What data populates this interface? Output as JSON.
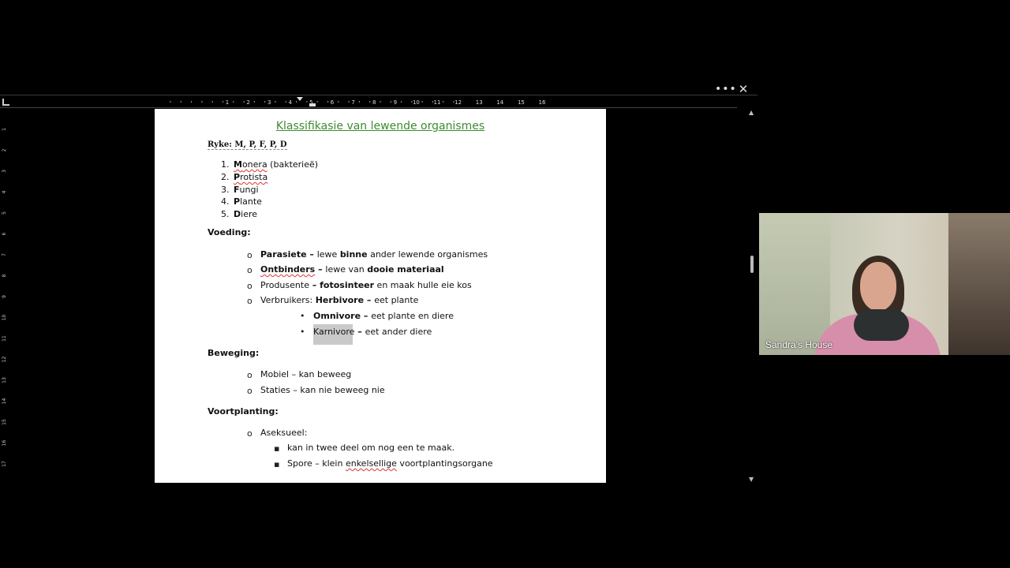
{
  "toolbar": {
    "more_icon": "more-horizontal-icon",
    "more_glyph": "•••",
    "close_icon": "close-icon",
    "close_glyph": "✕"
  },
  "ruler": {
    "h_ticks": [
      "1",
      "2",
      "3",
      "4",
      "5",
      "6",
      "7",
      "8",
      "9",
      "10",
      "11",
      "12",
      "13",
      "14",
      "15",
      "16"
    ],
    "v_ticks": [
      "1",
      "2",
      "3",
      "4",
      "5",
      "6",
      "7",
      "8",
      "9",
      "10",
      "11",
      "12",
      "13",
      "14",
      "15",
      "16",
      "17"
    ]
  },
  "document": {
    "title": "Klassifikasie van lewende organismes",
    "title_color": "#3d8b2f",
    "ryke_label": "Ryke: M, P, F, P, D",
    "kingdoms": [
      {
        "num": "1.",
        "first": "M",
        "name": "onera",
        "note": " (bakterieë)"
      },
      {
        "num": "2.",
        "first": "P",
        "name": "rotista",
        "note": ""
      },
      {
        "num": "3.",
        "first": "F",
        "name": "ungi",
        "note": ""
      },
      {
        "num": "4.",
        "first": "P",
        "name": "lante",
        "note": ""
      },
      {
        "num": "5.",
        "first": "D",
        "name": "iere",
        "note": ""
      }
    ],
    "voeding": {
      "heading": "Voeding:",
      "parasiete": {
        "term": "Parasiete",
        "dash": " – ",
        "a": "lewe ",
        "b": "binne",
        "c": " ander lewende organismes"
      },
      "ontbinders": {
        "term": "Ontbinders",
        "dash": " – ",
        "a": "lewe van ",
        "b": "dooie materiaal"
      },
      "produsente": {
        "term": "Produsente",
        "dash": " – ",
        "b": "fotosinteer",
        "c": " en maak hulle eie kos"
      },
      "verbruikers": {
        "term": "Verbruikers: ",
        "b": "Herbivore",
        "dash": " – ",
        "c": "eet plante"
      },
      "omnivore": {
        "term": "Omnivore",
        "dash": " – ",
        "c": "eet plante en diere"
      },
      "karnivore": {
        "term": "Karnivore",
        "dash": " – ",
        "c": "eet ander diere"
      }
    },
    "beweging": {
      "heading": "Beweging:",
      "items": [
        "Mobiel – kan beweeg",
        "Staties – kan nie beweeg nie"
      ]
    },
    "voortplanting": {
      "heading": "Voortplanting:",
      "aseksueel": "Aseksueel:",
      "sub1": "kan in twee deel om nog een te maak.",
      "sub2_a": "Spore – klein ",
      "sub2_b": "enkelsellige",
      "sub2_c": " voortplantingsorgane"
    }
  },
  "bullets": {
    "circle": "o",
    "dot": "•",
    "square": "▪"
  },
  "webcam": {
    "name": "Sandra's House"
  }
}
